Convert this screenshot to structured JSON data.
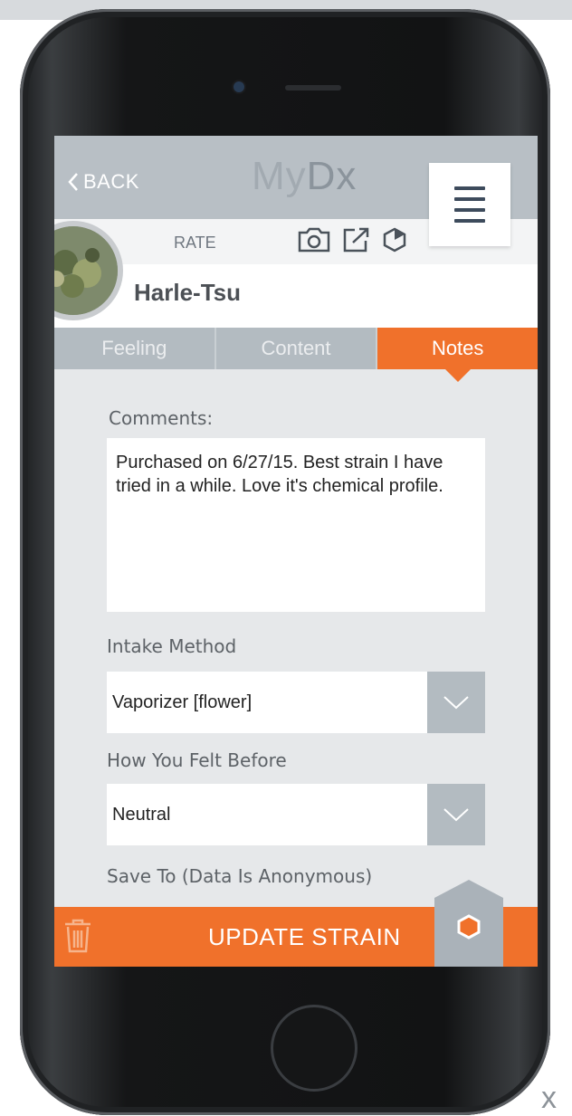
{
  "nav": {
    "back_label": "BACK",
    "logo_light": "My",
    "logo_bold": "Dx"
  },
  "subbar": {
    "rate_label": "RATE"
  },
  "strain": {
    "name": "Harle-Tsu"
  },
  "tabs": [
    {
      "label": "Feeling",
      "active": false
    },
    {
      "label": "Content",
      "active": false
    },
    {
      "label": "Notes",
      "active": true
    }
  ],
  "comments": {
    "label": "Comments:",
    "value": "Purchased on 6/27/15. Best strain I have tried in a while. Love it's chemical profile."
  },
  "intake_method": {
    "label": "Intake Method",
    "value": "Vaporizer [flower]"
  },
  "felt_before": {
    "label": "How You Felt Before",
    "value": "Neutral"
  },
  "save_to": {
    "label": "Save To (Data Is Anonymous)"
  },
  "action": {
    "update_label": "UPDATE STRAIN"
  },
  "icons": [
    "menu-icon",
    "camera-icon",
    "share-icon",
    "hexagon-icon",
    "trash-icon",
    "chevron-down-icon",
    "chevron-left-icon"
  ],
  "colors": {
    "accent": "#f0712b",
    "tab_inactive": "#b3bbc1",
    "nav_bg": "#b8bfc5",
    "menu_lines": "#3d4b5c"
  }
}
